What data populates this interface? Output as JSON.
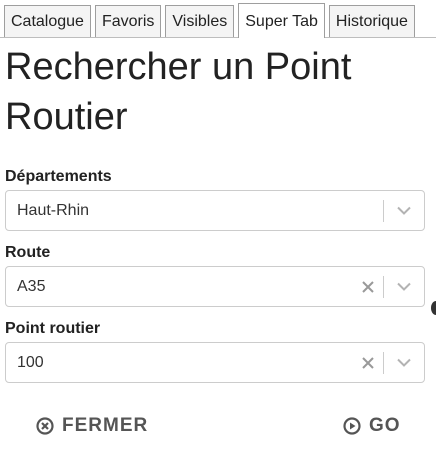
{
  "tabs": [
    {
      "label": "Catalogue",
      "active": false
    },
    {
      "label": "Favoris",
      "active": false
    },
    {
      "label": "Visibles",
      "active": false
    },
    {
      "label": "Super Tab",
      "active": true
    },
    {
      "label": "Historique",
      "active": false
    }
  ],
  "panel": {
    "title": "Rechercher un Point Routier"
  },
  "fields": {
    "departements": {
      "label": "Départements",
      "value": "Haut-Rhin",
      "clearable": false
    },
    "route": {
      "label": "Route",
      "value": "A35",
      "clearable": true
    },
    "point_routier": {
      "label": "Point routier",
      "value": "100",
      "clearable": true
    }
  },
  "actions": {
    "close_label": "FERMER",
    "go_label": "GO"
  },
  "icons": {
    "clear": "close-icon",
    "dropdown": "chevron-down-icon",
    "close_button": "close-circle-icon",
    "go_button": "play-circle-icon"
  },
  "colors": {
    "text": "#222222",
    "border": "#cccccc",
    "button_text": "#555555"
  }
}
